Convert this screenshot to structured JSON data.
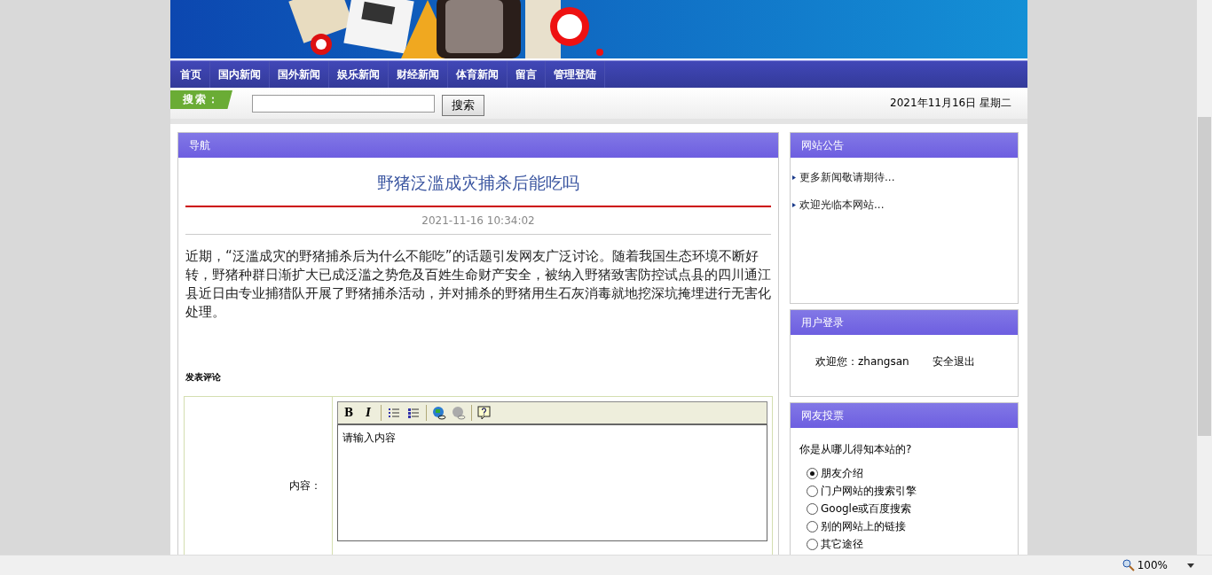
{
  "nav": {
    "items": [
      "首页",
      "国内新闻",
      "国外新闻",
      "娱乐新闻",
      "财经新闻",
      "体育新闻",
      "留言",
      "管理登陆"
    ]
  },
  "search": {
    "label": "搜索：",
    "button": "搜索"
  },
  "date": "2021年11月16日 星期二",
  "article": {
    "header": "导航",
    "title": "野猪泛滥成灾捕杀后能吃吗",
    "time": "2021-11-16 10:34:02",
    "body": "近期，“泛滥成灾的野猪捕杀后为什么不能吃”的话题引发网友广泛讨论。随着我国生态环境不断好转，野猪种群日渐扩大已成泛滥之势危及百姓生命财产安全，被纳入野猪致害防控试点县的四川通江县近日由专业捕猎队开展了野猪捕杀活动，并对捕杀的野猪用生石灰消毒就地挖深坑掩埋进行无害化处理。"
  },
  "comment": {
    "heading": "发表评论",
    "toolbar": [
      "B",
      "I"
    ],
    "content_label": "内容：",
    "placeholder": "请输入内容"
  },
  "notice": {
    "title": "网站公告",
    "items": [
      "更多新闻敬请期待...",
      "欢迎光临本网站..."
    ]
  },
  "login": {
    "title": "用户登录",
    "welcome": "欢迎您：zhangsan",
    "logout": "安全退出"
  },
  "vote": {
    "title": "网友投票",
    "question": "你是从哪儿得知本站的?",
    "options": [
      {
        "label": "朋友介绍",
        "selected": true
      },
      {
        "label": "门户网站的搜索引擎",
        "selected": false
      },
      {
        "label": "Google或百度搜索",
        "selected": false
      },
      {
        "label": "别的网站上的链接",
        "selected": false
      },
      {
        "label": "其它途径",
        "selected": false
      }
    ]
  },
  "status_bar": {
    "zoom": "100%"
  }
}
